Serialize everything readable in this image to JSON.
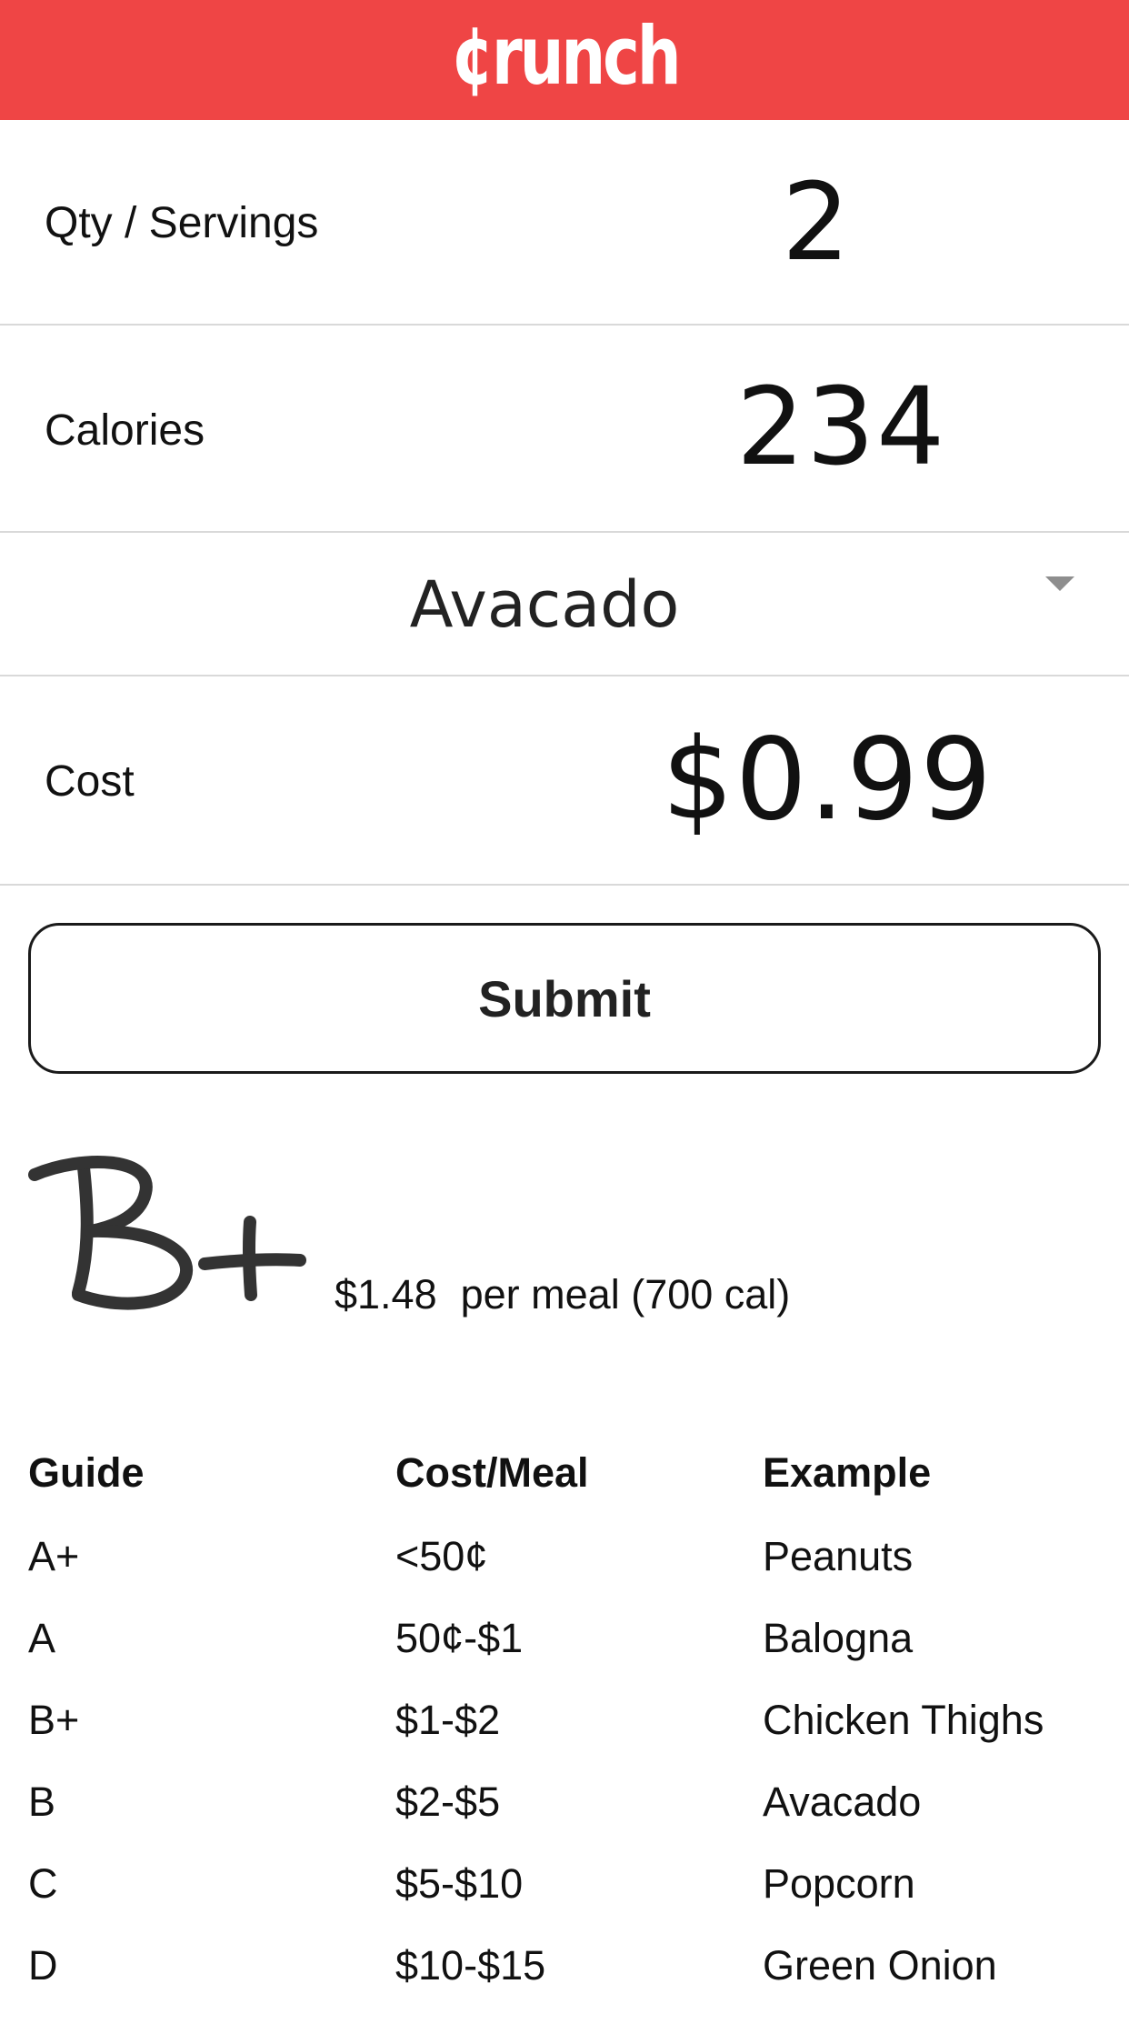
{
  "header": {
    "logo": "¢runch",
    "color": "#ef4545"
  },
  "form": {
    "qty_label": "Qty / Servings",
    "qty_value": "2",
    "calories_label": "Calories",
    "calories_value": "234",
    "food_selected": "Avacado",
    "cost_label": "Cost",
    "cost_value": "$0.99"
  },
  "submit_label": "Submit",
  "result": {
    "grade": "B+",
    "amount": "$1.48",
    "per_meal": "per meal (700 cal)"
  },
  "guide": {
    "headers": [
      "Guide",
      "Cost/Meal",
      "Example"
    ],
    "rows": [
      [
        "A+",
        "<50¢",
        "Peanuts"
      ],
      [
        "A",
        "50¢-$1",
        "Balogna"
      ],
      [
        "B+",
        "$1-$2",
        "Chicken Thighs"
      ],
      [
        "B",
        "$2-$5",
        "Avacado"
      ],
      [
        "C",
        "$5-$10",
        "Popcorn"
      ],
      [
        "D",
        "$10-$15",
        "Green Onion"
      ]
    ]
  }
}
